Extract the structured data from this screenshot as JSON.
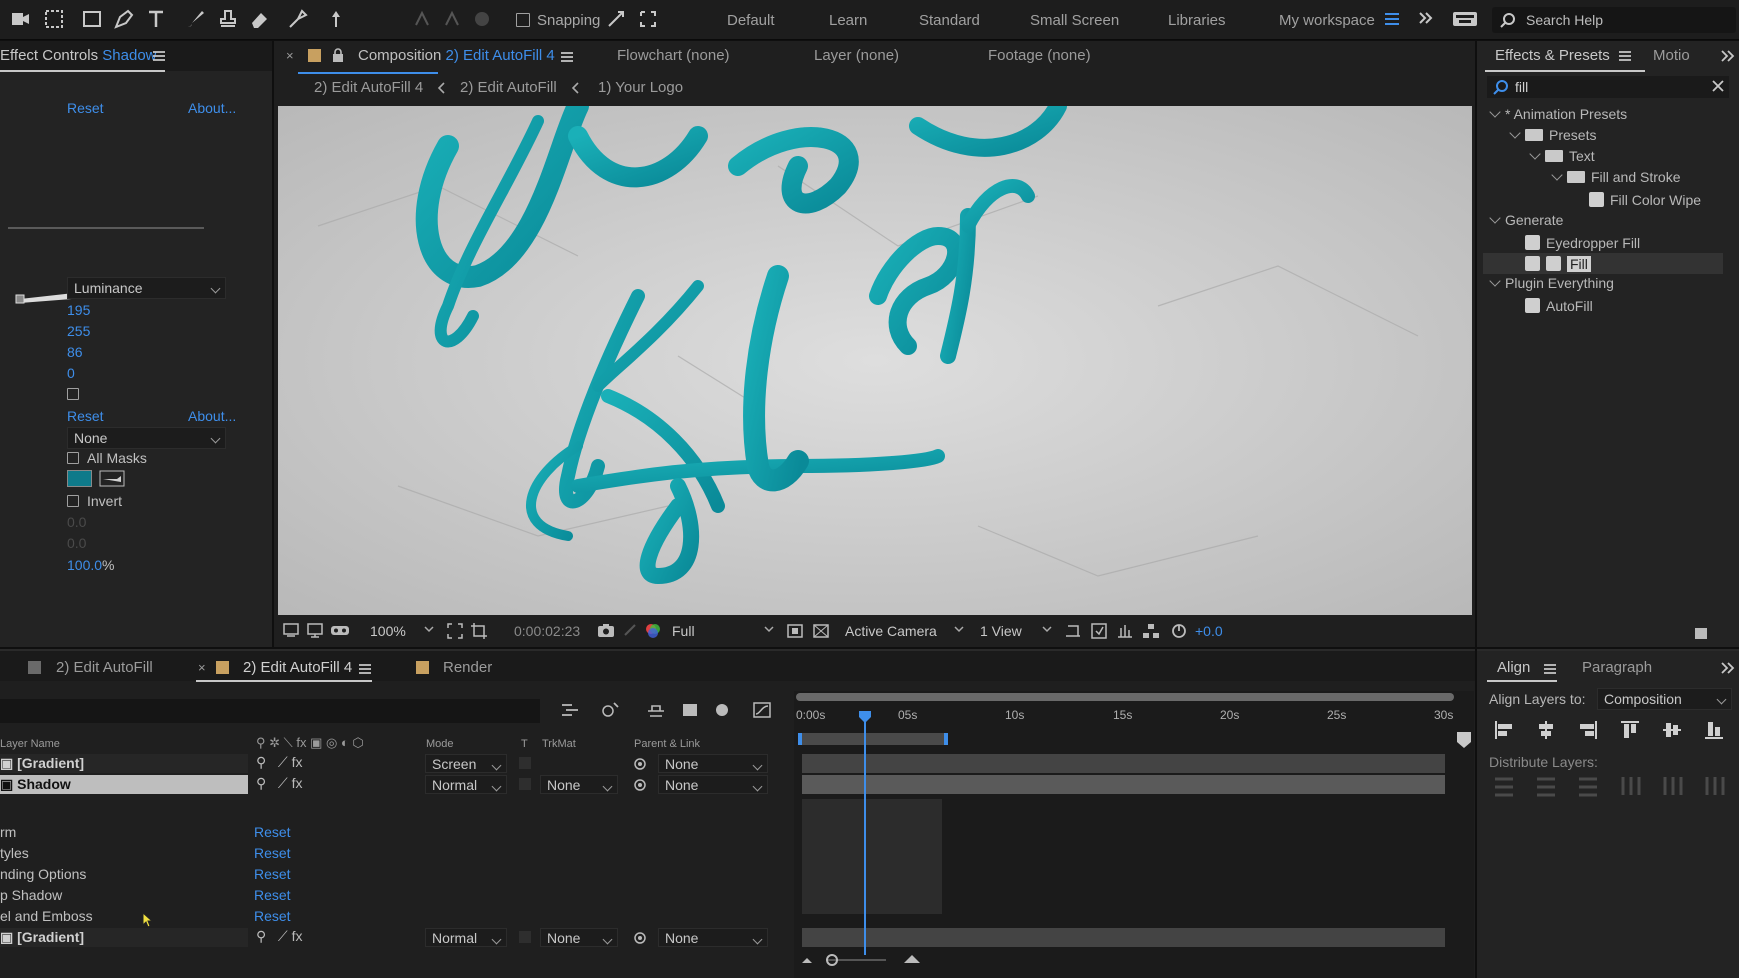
{
  "toolbar": {
    "snapping_label": "Snapping",
    "workspaces": [
      "Default",
      "Learn",
      "Standard",
      "Small Screen",
      "Libraries",
      "My workspace"
    ],
    "search_placeholder": "Search Help"
  },
  "effect_controls": {
    "tab_label": "Effect Controls",
    "tab_layer": "Shadow",
    "reset_label": "Reset",
    "about_label": "About...",
    "channel_value": "Luminance",
    "values": [
      "195",
      "255",
      "86",
      "0"
    ],
    "reset_label_2": "Reset",
    "about_label_2": "About...",
    "mask_value": "None",
    "all_masks_label": "All Masks",
    "invert_label": "Invert",
    "dim_values": [
      "0.0",
      "0.0"
    ],
    "percent_value": "100.0",
    "percent_unit": "%",
    "swatch_color": "#0e7a8a"
  },
  "composition": {
    "close_glyph": "×",
    "tab_prefix": "Composition",
    "tab_name": "2) Edit AutoFill 4",
    "other_tabs": [
      "Flowchart (none)",
      "Layer (none)",
      "Footage (none)"
    ],
    "breadcrumbs": [
      "2) Edit AutoFill 4",
      "2) Edit AutoFill",
      "1) Your Logo"
    ],
    "zoom": "100%",
    "timecode": "0:00:02:23",
    "resolution": "Full",
    "camera": "Active Camera",
    "views": "1 View",
    "exposure": "+0.0",
    "text_color": "#139eaa"
  },
  "effects_presets": {
    "tab_label": "Effects & Presets",
    "tab_overflow": "Motio",
    "search_value": "fill",
    "tree": [
      {
        "label": "* Animation Presets"
      },
      {
        "label": "Presets"
      },
      {
        "label": "Text"
      },
      {
        "label": "Fill and Stroke"
      },
      {
        "label": "Fill Color Wipe"
      },
      {
        "label": "Generate"
      },
      {
        "label": "Eyedropper Fill"
      },
      {
        "label": "Fill"
      },
      {
        "label": "Plugin Everything"
      },
      {
        "label": "AutoFill"
      }
    ]
  },
  "timeline": {
    "tabs": [
      "2) Edit AutoFill",
      "2) Edit AutoFill 4",
      "Render"
    ],
    "close_glyph": "×",
    "columns": {
      "layer_name": "Layer Name",
      "mode": "Mode",
      "t": "T",
      "trkmat": "TrkMat",
      "parent": "Parent & Link"
    },
    "layers": [
      {
        "name": "[Gradient]",
        "mode": "Screen",
        "trkmat": "",
        "parent": "None"
      },
      {
        "name": "Shadow",
        "mode": "Normal",
        "trkmat": "None",
        "parent": "None"
      },
      {
        "name": "[Gradient]",
        "mode": "Normal",
        "trkmat": "None",
        "parent": "None"
      }
    ],
    "layer_styles": [
      "rm",
      "tyles",
      "nding Options",
      "p Shadow",
      "el and Emboss"
    ],
    "reset_label": "Reset",
    "ruler": [
      "0:00s",
      "05s",
      "10s",
      "15s",
      "20s",
      "25s",
      "30s"
    ]
  },
  "align": {
    "tab_label": "Align",
    "tab_paragraph": "Paragraph",
    "align_to_label": "Align Layers to:",
    "align_to_value": "Composition",
    "distribute_label": "Distribute Layers:"
  }
}
